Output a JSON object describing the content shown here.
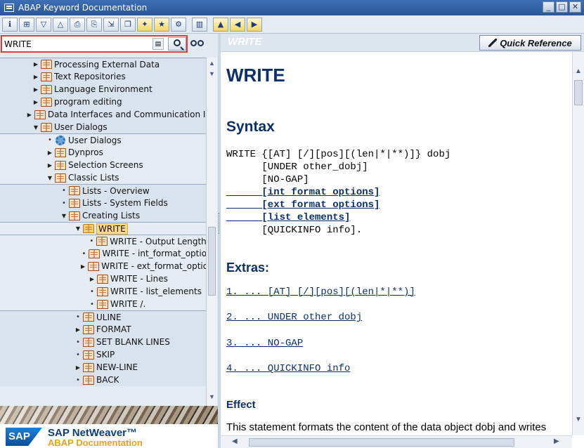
{
  "window": {
    "title": "ABAP Keyword Documentation",
    "controls": [
      "_",
      "□",
      "✕"
    ]
  },
  "toolbar": {
    "buttons": [
      "info",
      "tree",
      "expand",
      "collapse",
      "print",
      "print-preview",
      "export",
      "copy",
      "bookmark",
      "favorite",
      "settings",
      "layout",
      "up",
      "back",
      "forward"
    ]
  },
  "search": {
    "value": "WRITE",
    "history_label": "▤"
  },
  "tree": {
    "nodes": [
      {
        "label": "Processing External Data",
        "toggle": "▶",
        "icon": "book"
      },
      {
        "label": "Text Repositories",
        "toggle": "▶",
        "icon": "book"
      },
      {
        "label": "Language Environment",
        "toggle": "▶",
        "icon": "book"
      },
      {
        "label": "program editing",
        "toggle": "▶",
        "icon": "book"
      },
      {
        "label": "Data Interfaces and Communication Interfaces",
        "toggle": "▶",
        "icon": "book"
      },
      {
        "label": "User Dialogs",
        "toggle": "▼",
        "icon": "book"
      },
      {
        "label": "User Dialogs",
        "toggle": "•",
        "icon": "gear"
      },
      {
        "label": "Dynpros",
        "toggle": "▶",
        "icon": "book"
      },
      {
        "label": "Selection Screens",
        "toggle": "▶",
        "icon": "book"
      },
      {
        "label": "Classic Lists",
        "toggle": "▼",
        "icon": "book"
      },
      {
        "label": "Lists - Overview",
        "toggle": "•",
        "icon": "book"
      },
      {
        "label": "Lists - System Fields",
        "toggle": "•",
        "icon": "book"
      },
      {
        "label": "Creating Lists",
        "toggle": "▼",
        "icon": "book"
      },
      {
        "label": "WRITE",
        "toggle": "▼",
        "icon": "book"
      },
      {
        "label": "WRITE - Output Length",
        "toggle": "•",
        "icon": "book"
      },
      {
        "label": "WRITE - int_format_options",
        "toggle": "•",
        "icon": "book"
      },
      {
        "label": "WRITE - ext_format_options",
        "toggle": "▶",
        "icon": "book"
      },
      {
        "label": "WRITE - Lines",
        "toggle": "▶",
        "icon": "book"
      },
      {
        "label": "WRITE - list_elements",
        "toggle": "•",
        "icon": "book"
      },
      {
        "label": "WRITE /.",
        "toggle": "•",
        "icon": "book"
      },
      {
        "label": "ULINE",
        "toggle": "•",
        "icon": "book"
      },
      {
        "label": "FORMAT",
        "toggle": "▶",
        "icon": "book"
      },
      {
        "label": "SET BLANK LINES",
        "toggle": "•",
        "icon": "book"
      },
      {
        "label": "SKIP",
        "toggle": "•",
        "icon": "book"
      },
      {
        "label": "NEW-LINE",
        "toggle": "▶",
        "icon": "book"
      },
      {
        "label": "BACK",
        "toggle": "•",
        "icon": "book"
      }
    ]
  },
  "banner": {
    "sap": "SAP",
    "product": "SAP NetWeaver™",
    "subtitle": "ABAP Documentation"
  },
  "doc": {
    "header_ghost": "WRITE",
    "quick_reference": "Quick Reference",
    "title": "WRITE",
    "syntax_heading": "Syntax",
    "syntax_lines": [
      "WRITE {[AT] [/][pos][(len|*|**)]} dobj",
      "      [UNDER other_dobj]",
      "      [NO-GAP]",
      "      [int_format_options]",
      "      [ext_format_options]",
      "      [list_elements]",
      "      [QUICKINFO info]."
    ],
    "extras_heading": "Extras:",
    "extras": [
      "1. ... [AT] [/][pos][(len|*|**)]",
      "2. ... UNDER other_dobj",
      "3. ... NO-GAP",
      "4. ... QUICKINFO info"
    ],
    "effect_heading": "Effect",
    "effect_text": "This statement formats the content of the data object dobj and writes"
  }
}
